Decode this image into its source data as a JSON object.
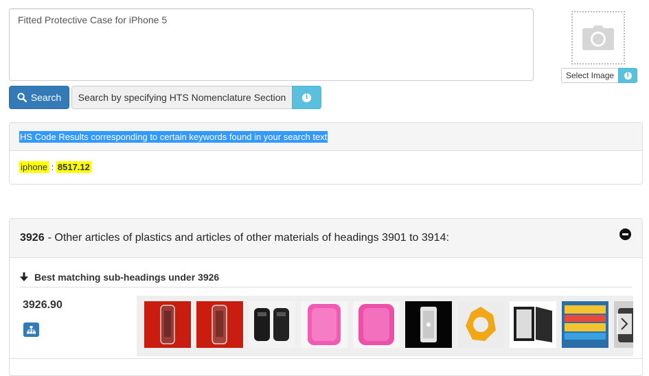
{
  "search": {
    "query": "Fitted Protective Case for iPhone 5",
    "search_label": "Search",
    "hts_label": "Search by specifying HTS Nomenclature Section",
    "info_glyph": "i"
  },
  "image_upload": {
    "select_label": "Select Image",
    "info_glyph": "i",
    "icon": "camera-icon"
  },
  "hs_results": {
    "header": "HS Code Results corresponding to certain keywords found in your search text",
    "keyword": "iphone",
    "separator": " : ",
    "code": "8517.12"
  },
  "heading": {
    "code": "3926",
    "title": "- Other articles of plastics and articles of other materials of headings 3901 to 3914:",
    "subheadings_label": "Best matching sub-headings under 3926",
    "subheading_code": "3926.90",
    "thumbnails": [
      {
        "icon": "clear-case-on-red-icon"
      },
      {
        "icon": "clear-case-on-red-icon"
      },
      {
        "icon": "black-cases-icon"
      },
      {
        "icon": "pink-case-icon"
      },
      {
        "icon": "pink-case-icon"
      },
      {
        "icon": "clear-case-on-black-icon"
      },
      {
        "icon": "yellow-holder-icon"
      },
      {
        "icon": "black-frames-icon"
      },
      {
        "icon": "colorful-packages-icon"
      },
      {
        "icon": "dark-case-icon"
      }
    ]
  },
  "colors": {
    "primary": "#337ab7",
    "info": "#5bc0de",
    "highlight": "#ffff00",
    "selection": "#3399ff"
  }
}
